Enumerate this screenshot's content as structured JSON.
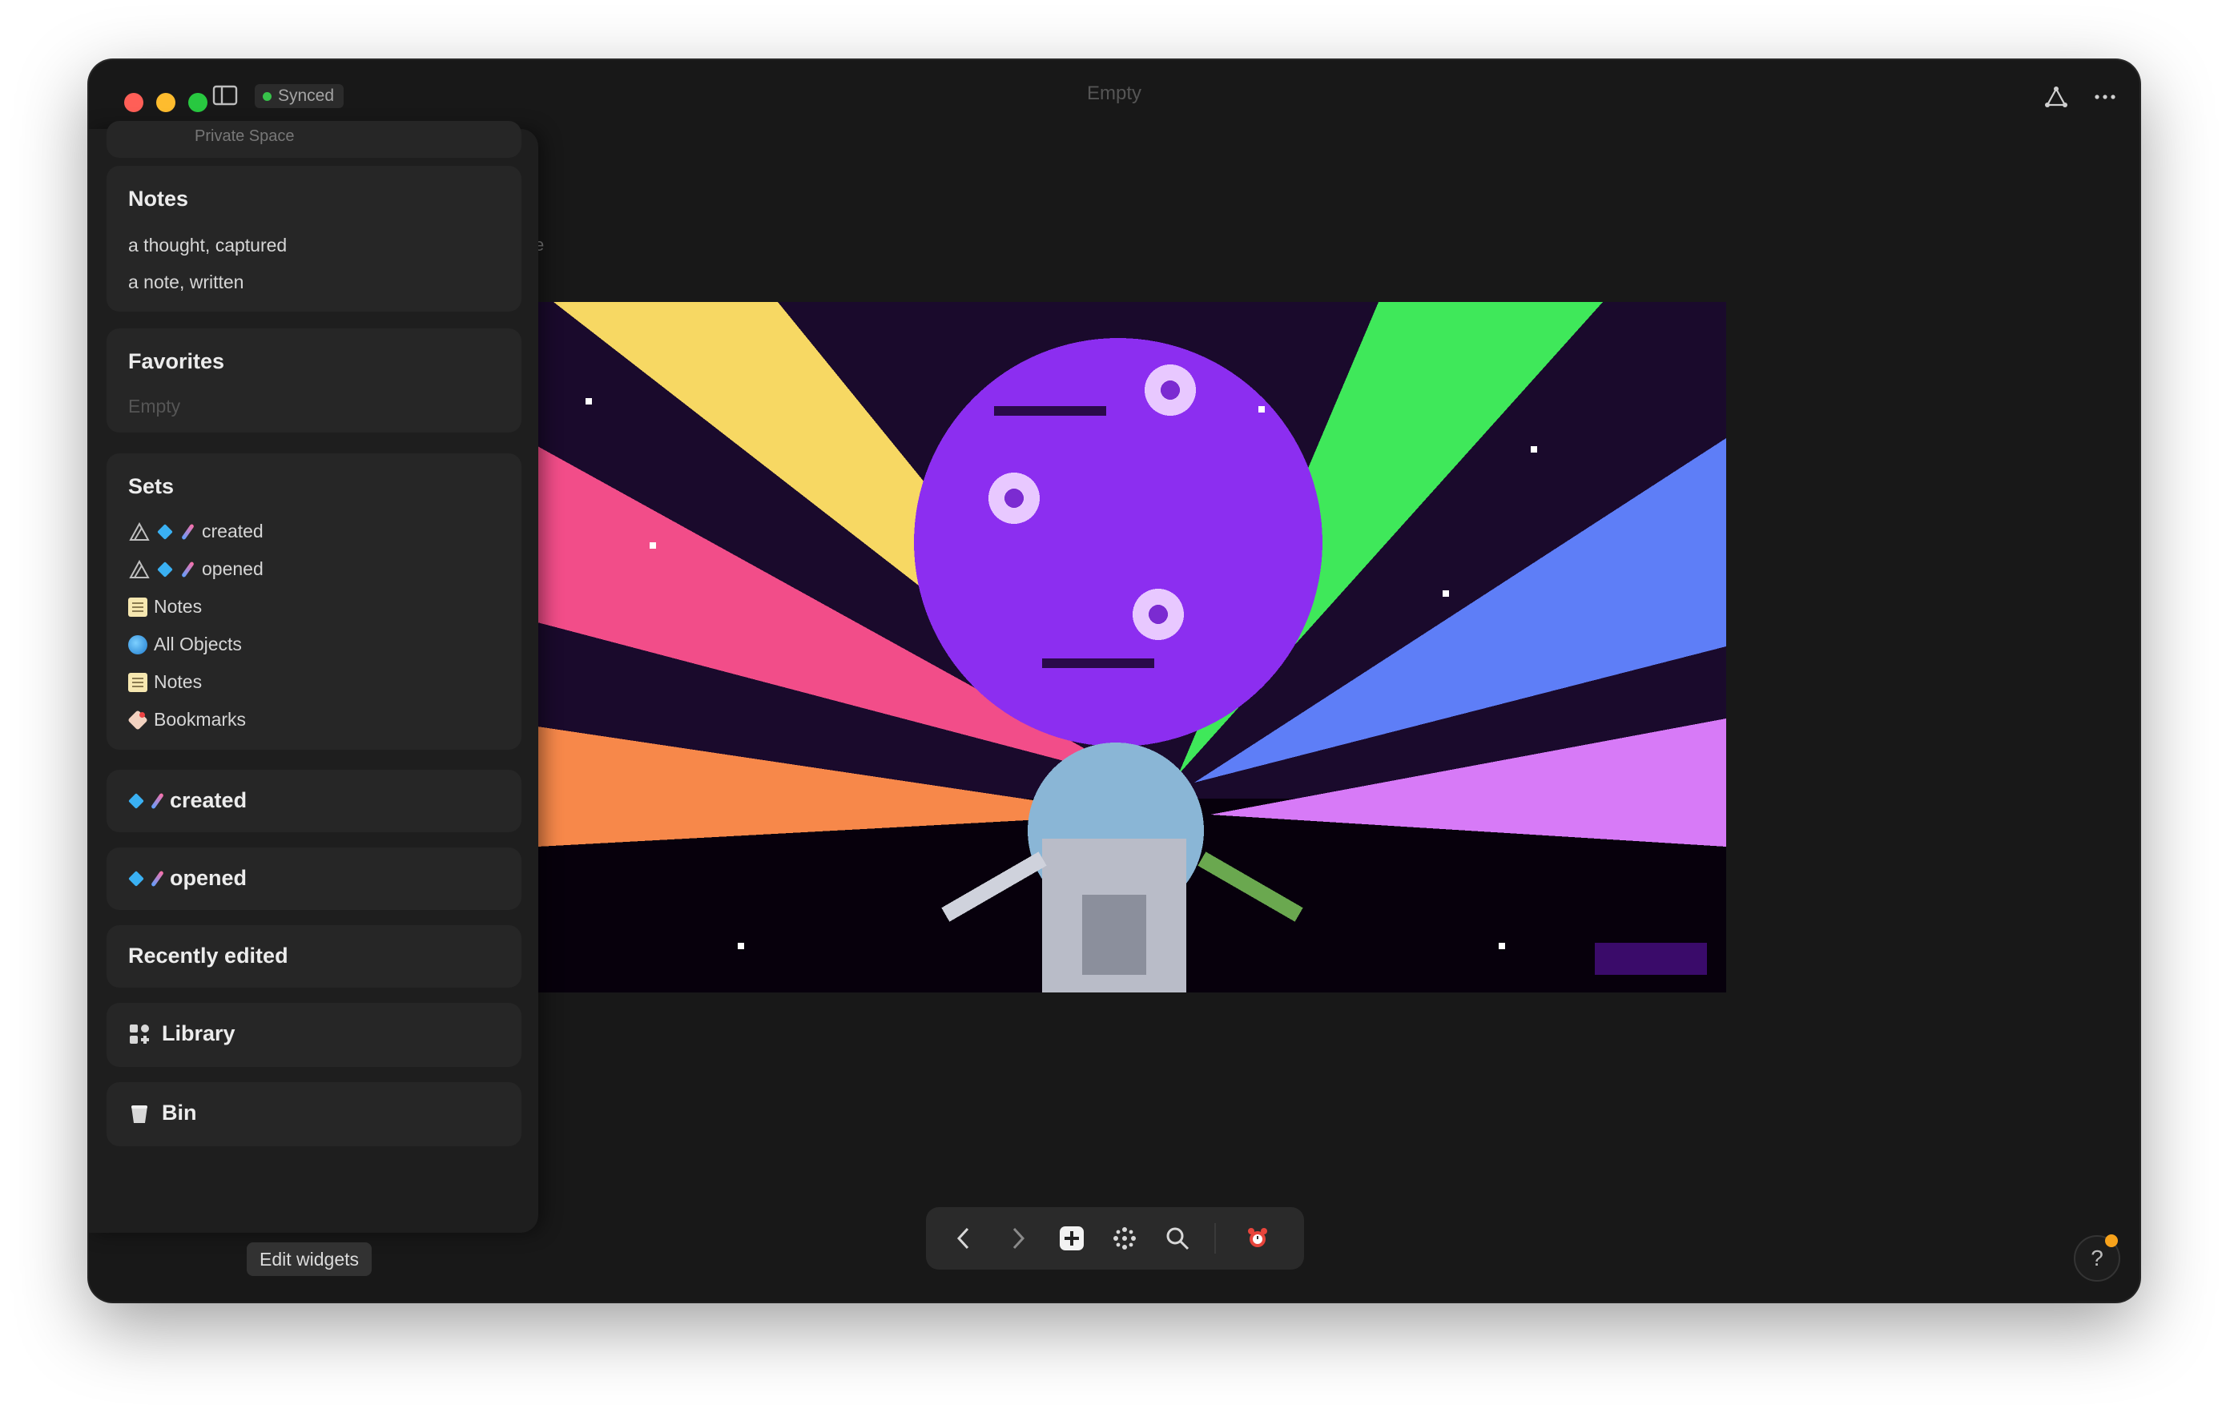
{
  "titlebar": {
    "sync_status": "Synced",
    "document_title": "Empty",
    "icons": [
      "sidebar-toggle-icon",
      "graph-icon",
      "more-icon"
    ]
  },
  "sidebar": {
    "space_name": "Private Space",
    "notes": {
      "title": "Notes",
      "items": [
        "a thought, captured",
        "a note, written"
      ]
    },
    "favorites": {
      "title": "Favorites",
      "empty_text": "Empty"
    },
    "sets": {
      "title": "Sets",
      "items": [
        {
          "label": "created",
          "icon": "gem-dna-icon"
        },
        {
          "label": "opened",
          "icon": "gem-dna-icon"
        },
        {
          "label": "Notes",
          "icon": "notes-icon"
        },
        {
          "label": "All Objects",
          "icon": "globe-icon"
        },
        {
          "label": "Notes",
          "icon": "notes-icon"
        },
        {
          "label": "Bookmarks",
          "icon": "tag-icon"
        }
      ]
    },
    "created_widget": "created",
    "opened_widget": "opened",
    "recently_edited": "Recently edited",
    "library": "Library",
    "bin": "Bin",
    "edit_widgets": "Edit widgets"
  },
  "canvas": {
    "partial_text": "e"
  },
  "bottom_bar": {
    "buttons": [
      "back-icon",
      "forward-icon",
      "add-icon",
      "graph-dots-icon",
      "search-icon",
      "alarm-icon"
    ]
  },
  "help": {
    "label": "?"
  },
  "colors": {
    "window_bg": "#181818",
    "sidebar_bg": "#1e1e1e",
    "widget_bg": "#262626",
    "synced_dot": "#37c24a",
    "help_dot": "#f7a21b"
  }
}
